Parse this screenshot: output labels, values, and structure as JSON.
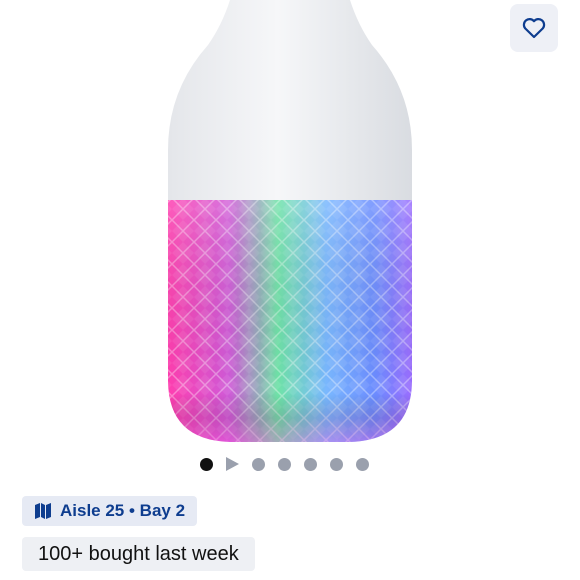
{
  "product": {
    "image_icon": "color-changing-bulb-image",
    "favorite_icon": "heart-icon"
  },
  "carousel": {
    "items": [
      "dot",
      "video",
      "dot",
      "dot",
      "dot",
      "dot",
      "dot"
    ],
    "active_index": 0,
    "count": 7
  },
  "location": {
    "icon": "map-icon",
    "label": "Aisle 25 • Bay 2"
  },
  "social_proof": {
    "label": "100+ bought last week"
  },
  "colors": {
    "accent_blue": "#0e3d8f",
    "chip_bg": "#e6eaf4",
    "active_dot": "#111111",
    "inactive_dot": "#9aa0ad"
  }
}
